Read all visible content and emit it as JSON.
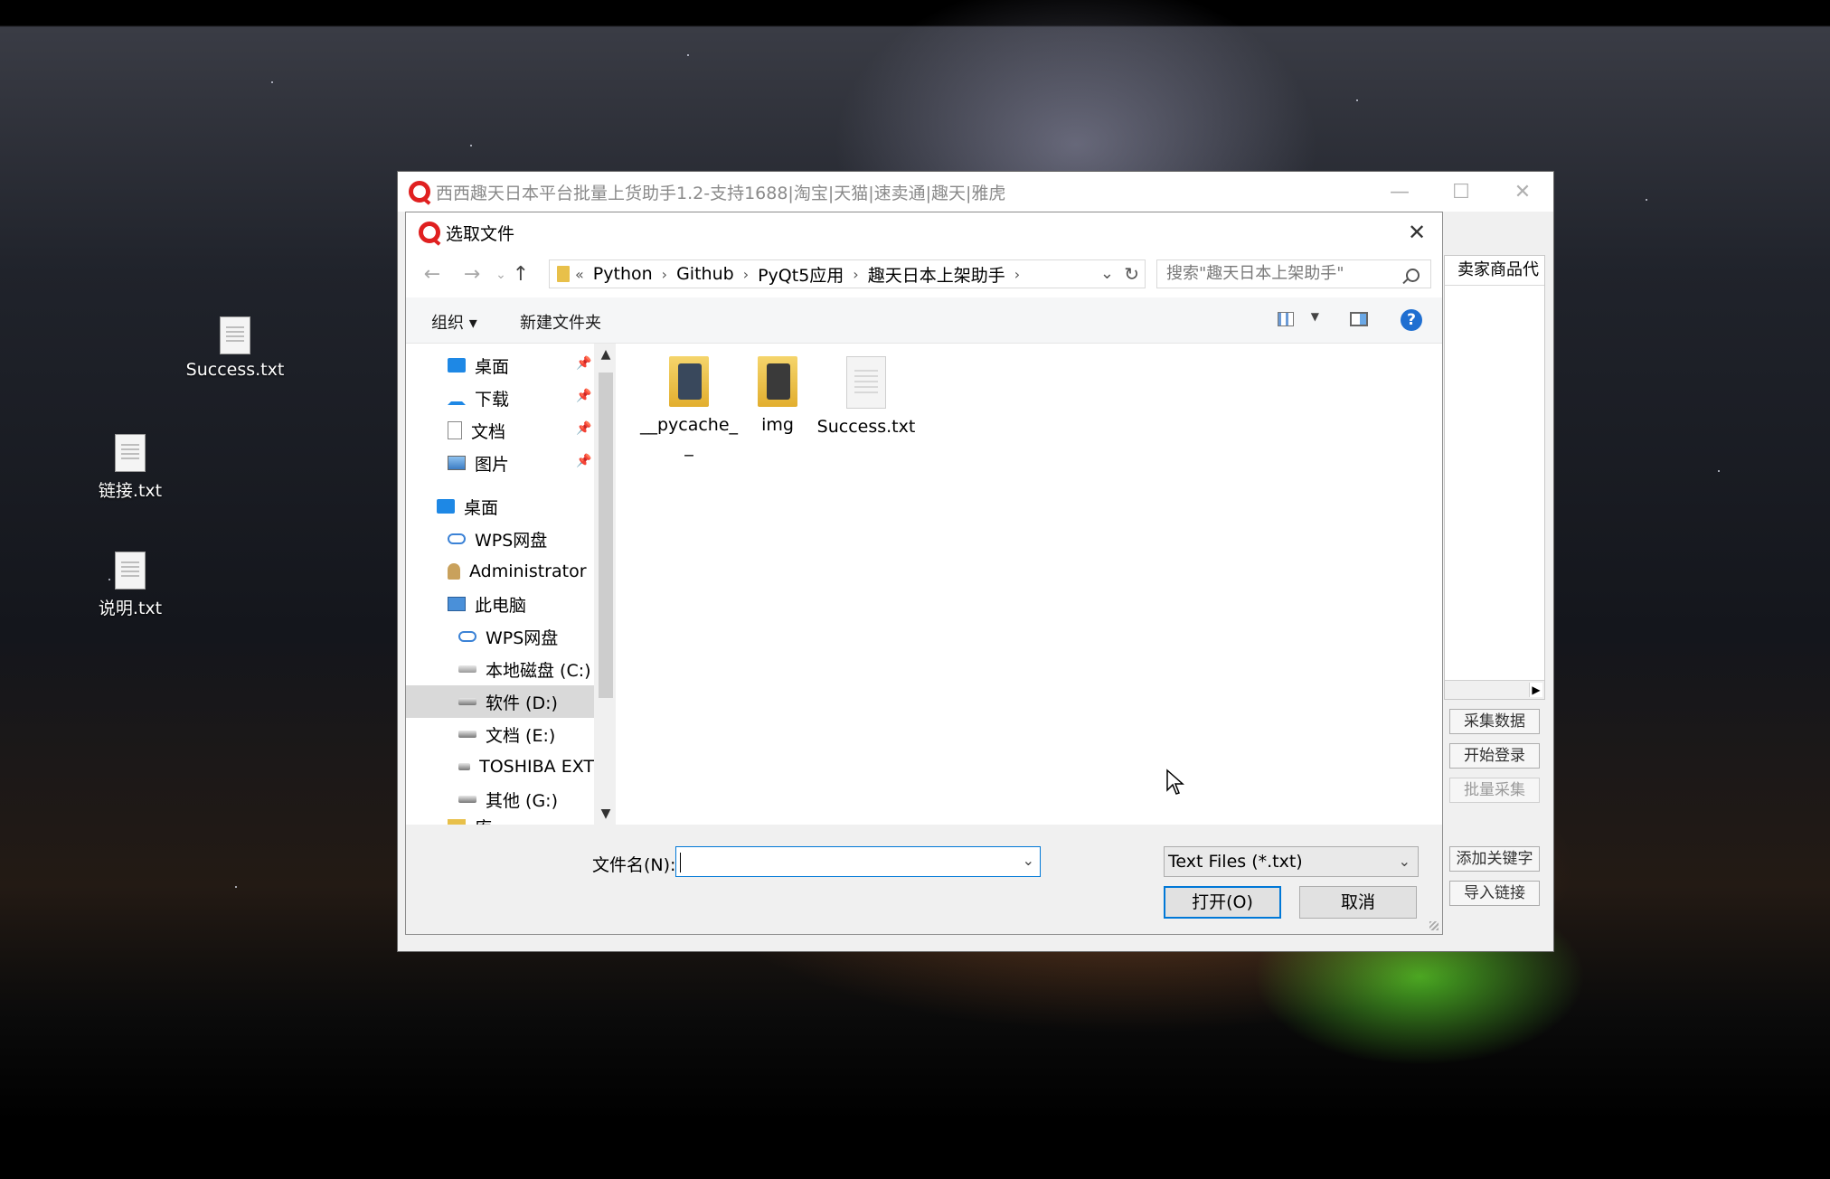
{
  "desktop": {
    "icons": [
      {
        "label": "Success.txt",
        "icon": "text-file-icon"
      },
      {
        "label": "链接.txt",
        "icon": "text-file-icon"
      },
      {
        "label": "说明.txt",
        "icon": "text-file-icon"
      }
    ]
  },
  "main_window": {
    "title": "西西趣天日本平台批量上货助手1.2-支持1688|淘宝|天猫|速卖通|趣天|雅虎",
    "minimize": "—",
    "maximize": "☐",
    "close": "✕",
    "right_panel_header": "卖家商品代",
    "buttons": [
      {
        "label": "采集数据",
        "enabled": true
      },
      {
        "label": "开始登录",
        "enabled": true
      },
      {
        "label": "批量采集",
        "enabled": false
      },
      {
        "label": "添加关键字",
        "enabled": true
      },
      {
        "label": "导入链接",
        "enabled": true
      }
    ]
  },
  "dialog": {
    "title": "选取文件",
    "close": "✕",
    "nav": {
      "back": "←",
      "forward": "→",
      "recent": "⌄",
      "up": "↑"
    },
    "breadcrumb": {
      "prefix": "«",
      "items": [
        "Python",
        "Github",
        "PyQt5应用",
        "趣天日本上架助手"
      ]
    },
    "search_placeholder": "搜索\"趣天日本上架助手\"",
    "toolbar": {
      "organize": "组织 ▾",
      "new_folder": "新建文件夹",
      "help": "?"
    },
    "nav_pane": {
      "quick_access": [
        {
          "label": "桌面",
          "icon": "desktop-icon",
          "pinned": true
        },
        {
          "label": "下载",
          "icon": "download-icon",
          "pinned": true
        },
        {
          "label": "文档",
          "icon": "document-icon",
          "pinned": true
        },
        {
          "label": "图片",
          "icon": "picture-icon",
          "pinned": true
        }
      ],
      "tree": [
        {
          "label": "桌面",
          "icon": "desktop-icon",
          "selected": false
        },
        {
          "label": "WPS网盘",
          "icon": "cloud-icon",
          "selected": false
        },
        {
          "label": "Administrator",
          "icon": "user-icon",
          "selected": false
        },
        {
          "label": "此电脑",
          "icon": "computer-icon",
          "selected": false
        },
        {
          "label": "WPS网盘",
          "icon": "cloud-icon",
          "selected": false
        },
        {
          "label": "本地磁盘 (C:)",
          "icon": "drive-icon",
          "selected": false
        },
        {
          "label": "软件 (D:)",
          "icon": "drive-icon",
          "selected": true
        },
        {
          "label": "文档 (E:)",
          "icon": "drive-icon",
          "selected": false
        },
        {
          "label": "TOSHIBA EXT",
          "icon": "drive-icon",
          "selected": false
        },
        {
          "label": "其他 (G:)",
          "icon": "drive-icon",
          "selected": false
        },
        {
          "label": "库",
          "icon": "library-icon",
          "selected": false
        }
      ]
    },
    "files": [
      {
        "name": "__pycache__",
        "type": "folder"
      },
      {
        "name": "img",
        "type": "folder"
      },
      {
        "name": "Success.txt",
        "type": "text-file"
      }
    ],
    "filename_label": "文件名(N):",
    "filename_value": "",
    "filetype_value": "Text Files (*.txt)",
    "open_button": "打开(O)",
    "cancel_button": "取消"
  }
}
